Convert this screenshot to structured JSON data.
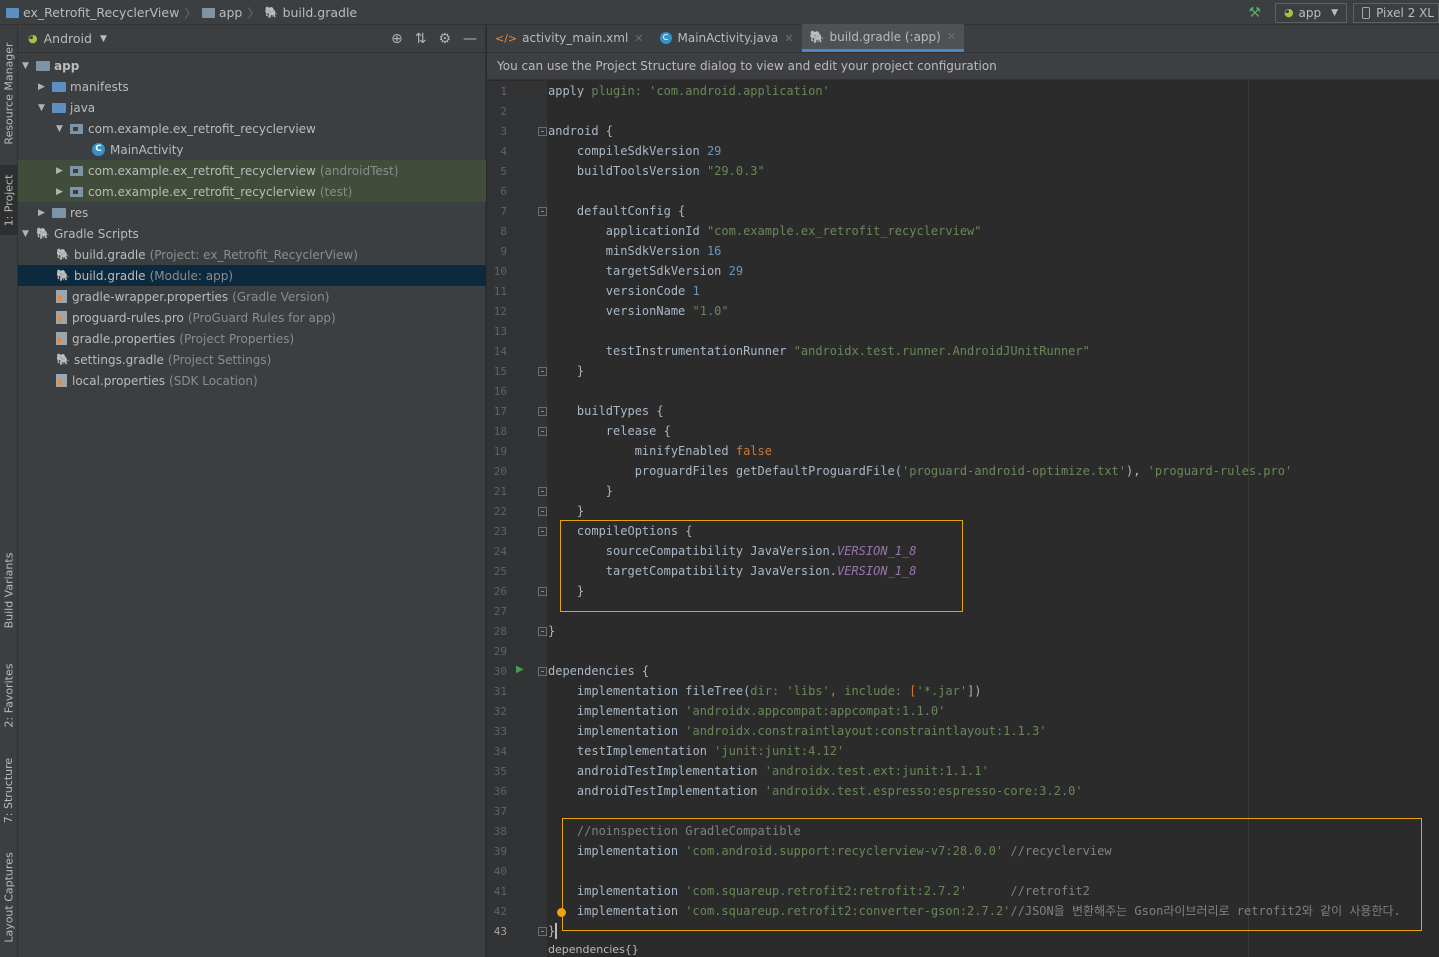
{
  "breadcrumb": {
    "project": "ex_Retrofit_RecyclerView",
    "module": "app",
    "file": "build.gradle"
  },
  "toolbar": {
    "run_config": "app",
    "device": "Pixel 2 XL"
  },
  "side_tabs": [
    "Resource Manager",
    "1: Project",
    "Build Variants",
    "2: Favorites",
    "7: Structure",
    "Layout Captures"
  ],
  "project_panel": {
    "view": "Android",
    "tree": [
      {
        "label": "app",
        "note": ""
      },
      {
        "label": "manifests",
        "note": ""
      },
      {
        "label": "java",
        "note": ""
      },
      {
        "label": "com.example.ex_retrofit_recyclerview",
        "note": ""
      },
      {
        "label": "MainActivity",
        "note": ""
      },
      {
        "label": "com.example.ex_retrofit_recyclerview",
        "note": "(androidTest)"
      },
      {
        "label": "com.example.ex_retrofit_recyclerview",
        "note": "(test)"
      },
      {
        "label": "res",
        "note": ""
      },
      {
        "label": "Gradle Scripts",
        "note": ""
      },
      {
        "label": "build.gradle",
        "note": "(Project: ex_Retrofit_RecyclerView)"
      },
      {
        "label": "build.gradle",
        "note": "(Module: app)"
      },
      {
        "label": "gradle-wrapper.properties",
        "note": "(Gradle Version)"
      },
      {
        "label": "proguard-rules.pro",
        "note": "(ProGuard Rules for app)"
      },
      {
        "label": "gradle.properties",
        "note": "(Project Properties)"
      },
      {
        "label": "settings.gradle",
        "note": "(Project Settings)"
      },
      {
        "label": "local.properties",
        "note": "(SDK Location)"
      }
    ]
  },
  "tabs": [
    {
      "label": "activity_main.xml"
    },
    {
      "label": "MainActivity.java"
    },
    {
      "label": "build.gradle (:app)"
    }
  ],
  "banner": "You can use the Project Structure dialog to view and edit your project configuration",
  "line_numbers": [
    "1",
    "2",
    "3",
    "4",
    "5",
    "6",
    "7",
    "8",
    "9",
    "10",
    "11",
    "12",
    "13",
    "14",
    "15",
    "16",
    "17",
    "18",
    "19",
    "20",
    "21",
    "22",
    "23",
    "24",
    "25",
    "26",
    "27",
    "28",
    "29",
    "30",
    "31",
    "32",
    "33",
    "34",
    "35",
    "36",
    "37",
    "38",
    "39",
    "40",
    "41",
    "42",
    "43"
  ],
  "code": [
    [
      "apply ",
      "plugin: ",
      "'com.android.application'"
    ],
    [],
    [
      "android {"
    ],
    [
      "    compileSdkVersion ",
      "29"
    ],
    [
      "    buildToolsVersion ",
      "\"29.0.3\""
    ],
    [],
    [
      "    defaultConfig {"
    ],
    [
      "        applicationId ",
      "\"com.example.ex_retrofit_recyclerview\""
    ],
    [
      "        minSdkVersion ",
      "16"
    ],
    [
      "        targetSdkVersion ",
      "29"
    ],
    [
      "        versionCode ",
      "1"
    ],
    [
      "        versionName ",
      "\"1.0\""
    ],
    [],
    [
      "        testInstrumentationRunner ",
      "\"androidx.test.runner.AndroidJUnitRunner\""
    ],
    [
      "    }"
    ],
    [],
    [
      "    buildTypes {"
    ],
    [
      "        release {"
    ],
    [
      "            minifyEnabled ",
      "false"
    ],
    [
      "            proguardFiles getDefaultProguardFile(",
      "'proguard-android-optimize.txt'",
      "), ",
      "'proguard-rules.pro'"
    ],
    [
      "        }"
    ],
    [
      "    }"
    ],
    [
      "    compileOptions {"
    ],
    [
      "        sourceCompatibility JavaVersion.",
      "VERSION_1_8"
    ],
    [
      "        targetCompatibility JavaVersion.",
      "VERSION_1_8"
    ],
    [
      "    }"
    ],
    [],
    [
      "}"
    ],
    [],
    [
      "dependencies {"
    ],
    [
      "    implementation fileTree(",
      "dir: ",
      "'libs'",
      ", ",
      "include: ",
      "[",
      "'*.jar'",
      "])"
    ],
    [
      "    implementation ",
      "'androidx.appcompat:appcompat:1.1.0'"
    ],
    [
      "    implementation ",
      "'androidx.constraintlayout:constraintlayout:1.1.3'"
    ],
    [
      "    testImplementation ",
      "'junit:junit:4.12'"
    ],
    [
      "    androidTestImplementation ",
      "'androidx.test.ext:junit:1.1.1'"
    ],
    [
      "    androidTestImplementation ",
      "'androidx.test.espresso:espresso-core:3.2.0'"
    ],
    [],
    [
      "    //noinspection GradleCompatible"
    ],
    [
      "    implementation ",
      "'com.android.support:recyclerview-v7:28.0.0'",
      " //recyclerview"
    ],
    [],
    [
      "    implementation ",
      "'com.squareup.retrofit2:retrofit:2.7.2'",
      "      //retrofit2"
    ],
    [
      "    implementation ",
      "'com.squareup.retrofit2:converter-gson:2.7.2'",
      "//JSON을 변환해주는 Gson라이브러리로 retrofit2와 같이 사용한다."
    ],
    [
      "}"
    ]
  ],
  "breadcrumb_footer": "dependencies{}"
}
